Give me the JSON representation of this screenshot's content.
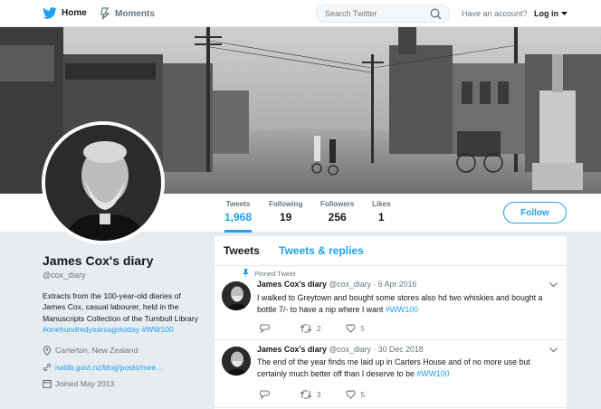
{
  "nav": {
    "home": "Home",
    "moments": "Moments",
    "search_placeholder": "Search Twitter",
    "account_prompt": "Have an account?",
    "login": "Log in"
  },
  "stats": [
    {
      "label": "Tweets",
      "value": "1,968"
    },
    {
      "label": "Following",
      "value": "19"
    },
    {
      "label": "Followers",
      "value": "256"
    },
    {
      "label": "Likes",
      "value": "1"
    }
  ],
  "follow_button": "Follow",
  "profile": {
    "name": "James Cox's diary",
    "handle": "@cox_diary",
    "bio": "Extracts from the 100-year-old diaries of James Cox, casual labourer, held in the Manuscripts Collection of the Turnbull Library",
    "bio_hashtag1": "#onehundredyearsagotoday",
    "bio_hashtag2": "#WW100",
    "location": "Carterton, New Zealand",
    "url": "natlib.govt.nz/blog/posts/mee...",
    "joined": "Joined May 2013"
  },
  "tabs": [
    "Tweets",
    "Tweets & replies"
  ],
  "tweets": [
    {
      "pinned_label": "Pinned Tweet",
      "name": "James Cox's diary",
      "meta": "@cox_diary · 6 Apr 2016",
      "text": "I walked to Greytown and bought some stores also hd two whiskies and bought a bottle 7/- to have a nip where I want",
      "hashtag": "#WW100",
      "retweets": "2",
      "likes": "5"
    },
    {
      "name": "James Cox's diary",
      "meta": "@cox_diary · 30 Dec 2018",
      "text": "The end of the year finds me laid up in Carters House and of no more use but certainly much better off than I deserve to be",
      "hashtag": "#WW100",
      "retweets": "3",
      "likes": "5"
    }
  ],
  "colors": {
    "accent": "#1da1f2",
    "text": "#14171a",
    "muted": "#66757f",
    "background": "#e6ecf0"
  },
  "icons": [
    "twitter-bird-icon",
    "moments-icon",
    "search-icon",
    "chevron-down-icon",
    "pin-icon",
    "location-icon",
    "link-icon",
    "calendar-icon",
    "reply-icon",
    "retweet-icon",
    "heart-icon"
  ]
}
